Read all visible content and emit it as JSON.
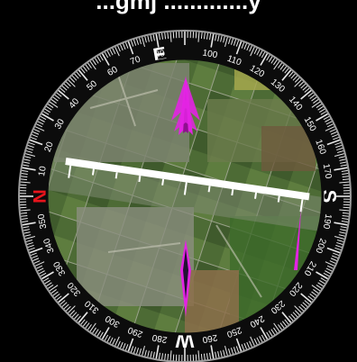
{
  "header": {
    "caption": "...gmj .............y"
  },
  "compass": {
    "cardinals": [
      {
        "label": "E",
        "deg": 80,
        "color": "#ffffff"
      },
      {
        "label": "S",
        "deg": 180,
        "color": "#ffffff"
      },
      {
        "label": "W",
        "deg": 270,
        "color": "#ffffff"
      },
      {
        "label": "N",
        "deg": 0,
        "color": "#e8141c"
      }
    ],
    "degree_labels": [
      "10",
      "20",
      "30",
      "40",
      "50",
      "60",
      "70",
      "80",
      "100",
      "110",
      "120",
      "130",
      "140",
      "150",
      "160",
      "170",
      "190",
      "200",
      "210",
      "220",
      "230",
      "240",
      "250",
      "260",
      "280",
      "290",
      "300",
      "310",
      "320",
      "330",
      "340",
      "350"
    ],
    "bezel_color": "#0c0c0c",
    "tick_color": "#e6e6e6",
    "needle_color": "#e323e3",
    "ruler_color": "#ffffff"
  },
  "icons": [
    "compass-dial-icon",
    "north-arrow-icon",
    "south-arrow-icon",
    "runway-ruler-icon"
  ]
}
